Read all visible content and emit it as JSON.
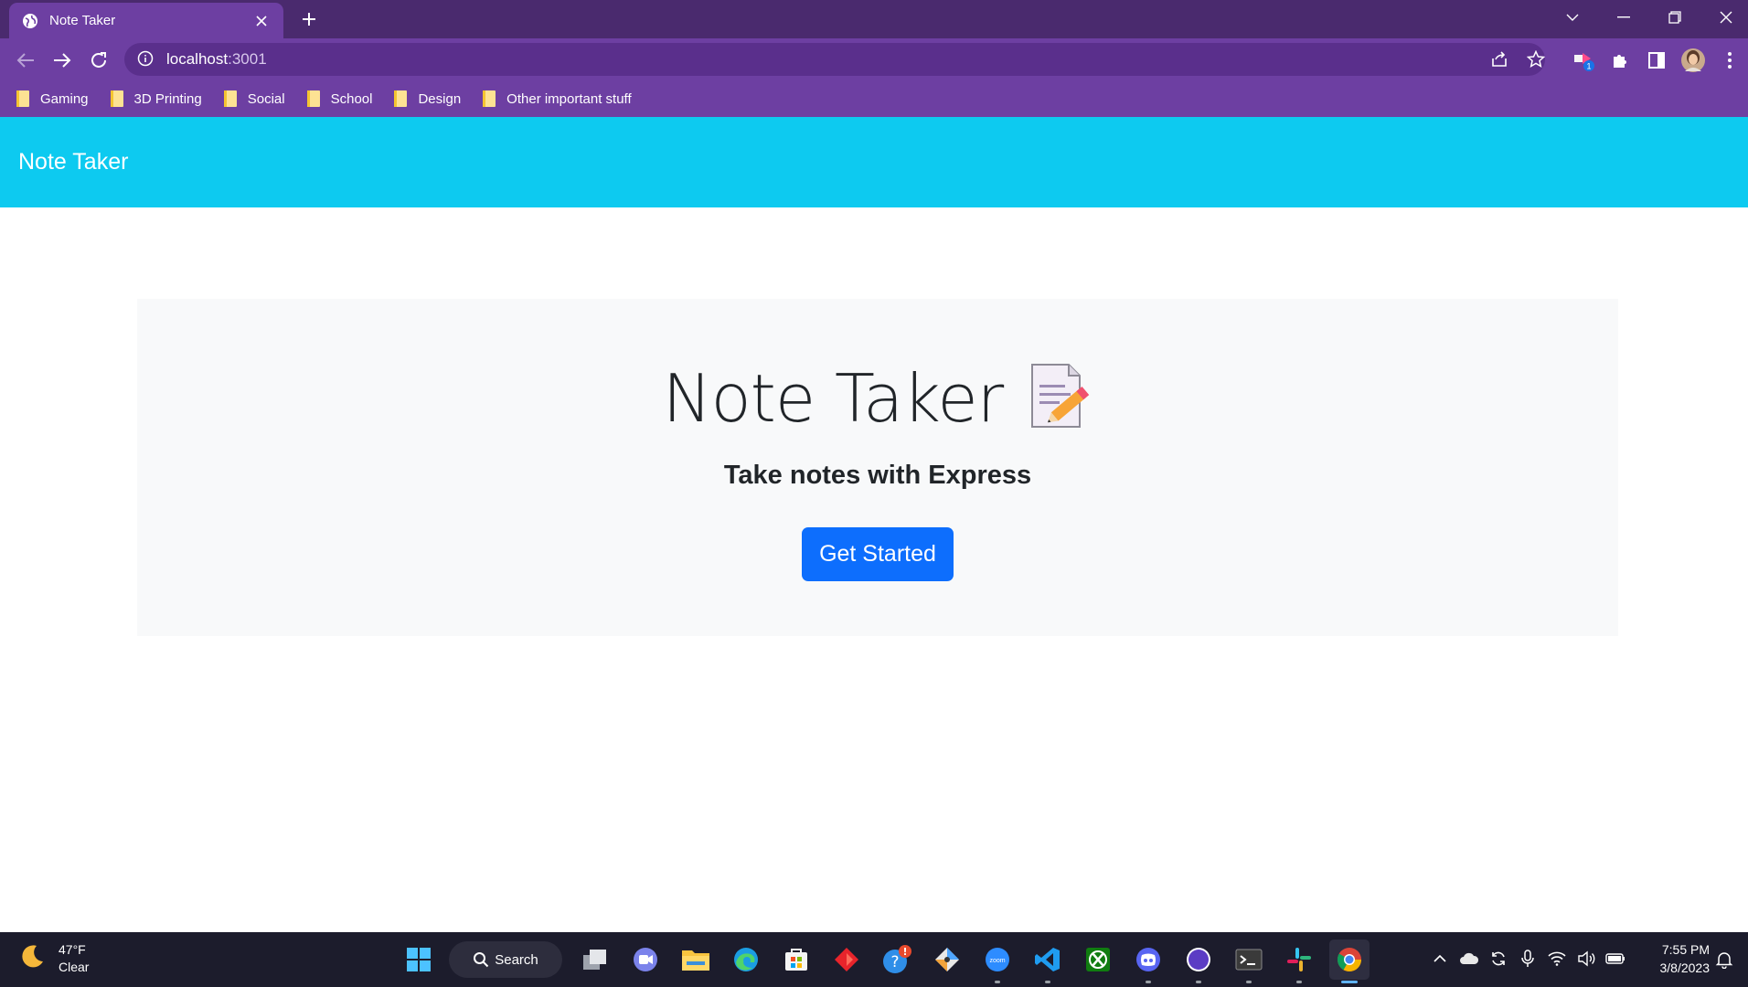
{
  "browser": {
    "tab_title": "Note Taker",
    "url_host": "localhost",
    "url_rest": ":3001",
    "extension_badge": "1",
    "bookmarks": [
      {
        "label": "Gaming"
      },
      {
        "label": "3D Printing"
      },
      {
        "label": "Social"
      },
      {
        "label": "School"
      },
      {
        "label": "Design"
      },
      {
        "label": "Other important stuff"
      }
    ]
  },
  "page": {
    "brand": "Note Taker",
    "hero_title": "Note Taker",
    "hero_subtitle": "Take notes with Express",
    "cta_label": "Get Started"
  },
  "taskbar": {
    "weather_temp": "47°F",
    "weather_cond": "Clear",
    "search_label": "Search",
    "time": "7:55 PM",
    "date": "3/8/2023",
    "apps": [
      {
        "icon": "start-icon"
      },
      {
        "icon": "task-view-icon"
      },
      {
        "icon": "teams-icon"
      },
      {
        "icon": "file-explorer-icon"
      },
      {
        "icon": "edge-icon"
      },
      {
        "icon": "store-icon"
      },
      {
        "icon": "red-app-icon"
      },
      {
        "icon": "help-icon"
      },
      {
        "icon": "git-app-icon"
      },
      {
        "icon": "zoom-icon"
      },
      {
        "icon": "vscode-icon"
      },
      {
        "icon": "xbox-icon"
      },
      {
        "icon": "discord-icon"
      },
      {
        "icon": "purple-app-icon"
      },
      {
        "icon": "terminal-icon"
      },
      {
        "icon": "slack-icon"
      },
      {
        "icon": "chrome-icon"
      }
    ],
    "zoom_text": "zoom"
  },
  "colors": {
    "titlebar": "#4a2a6e",
    "toolbar": "#6d3fa2",
    "navbar": "#0dcaf0",
    "jumbotron": "#f8f9fa",
    "primary_button": "#0d6efd"
  }
}
